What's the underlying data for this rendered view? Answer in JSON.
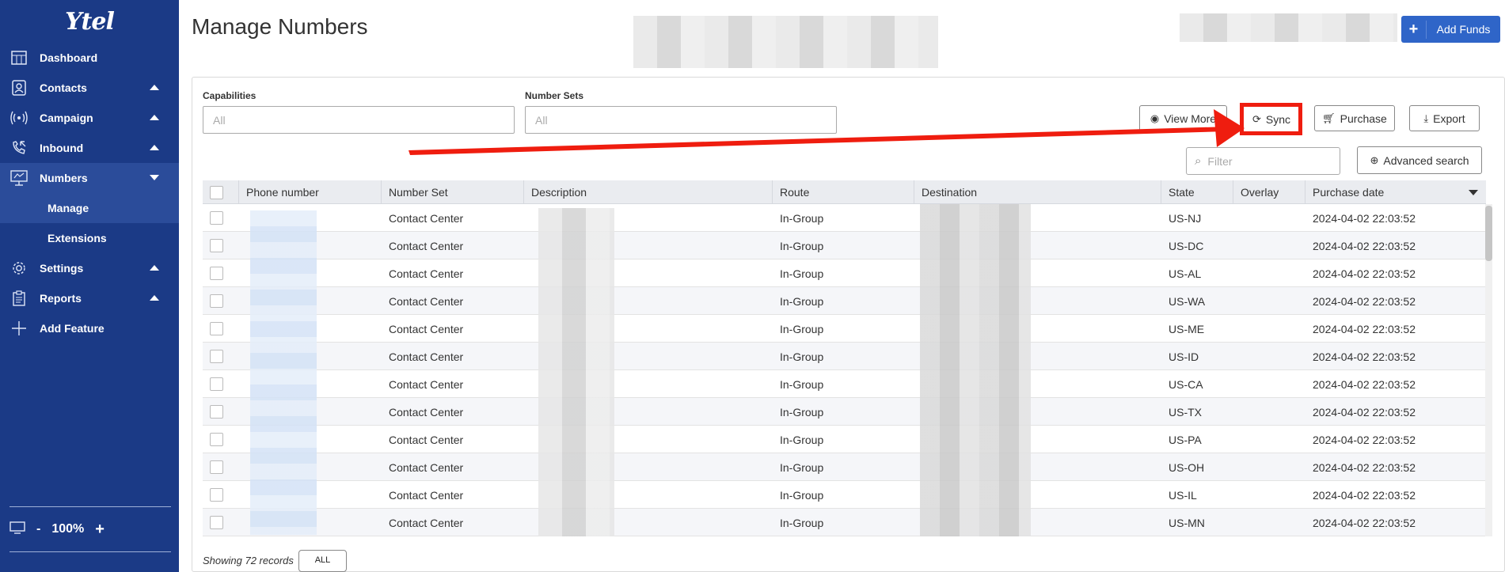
{
  "app": {
    "logo": "Ytel",
    "page_title": "Manage Numbers"
  },
  "sidebar": {
    "items": [
      {
        "label": "Dashboard",
        "icon": "dashboard-icon",
        "caret": ""
      },
      {
        "label": "Contacts",
        "icon": "contacts-icon",
        "caret": "up"
      },
      {
        "label": "Campaign",
        "icon": "campaign-icon",
        "caret": "up"
      },
      {
        "label": "Inbound",
        "icon": "inbound-icon",
        "caret": "up"
      },
      {
        "label": "Numbers",
        "icon": "numbers-icon",
        "caret": "down"
      }
    ],
    "numbers_sub": [
      {
        "label": "Manage"
      },
      {
        "label": "Extensions"
      }
    ],
    "lower_items": [
      {
        "label": "Settings",
        "icon": "gear-icon",
        "caret": "up"
      },
      {
        "label": "Reports",
        "icon": "reports-icon",
        "caret": "up"
      },
      {
        "label": "Add Feature",
        "icon": "plus-icon",
        "caret": ""
      }
    ],
    "zoom": {
      "minus": "-",
      "level": "100%",
      "plus": "+"
    }
  },
  "header": {
    "add_funds_plus": "+",
    "add_funds_label": "Add Funds"
  },
  "filters": {
    "capabilities_label": "Capabilities",
    "capabilities_placeholder": "All",
    "number_sets_label": "Number Sets",
    "number_sets_placeholder": "All",
    "filter_placeholder": "Filter"
  },
  "actions": {
    "view_more": "View More",
    "sync": "Sync",
    "purchase": "Purchase",
    "export": "Export",
    "advanced_search": "Advanced search"
  },
  "table": {
    "columns": [
      "Phone number",
      "Number Set",
      "Description",
      "Route",
      "Destination",
      "State",
      "Overlay",
      "Purchase date"
    ],
    "rows": [
      {
        "number_set": "Contact Center",
        "route": "In-Group",
        "state": "US-NJ",
        "purchase_date": "2024-04-02 22:03:52"
      },
      {
        "number_set": "Contact Center",
        "route": "In-Group",
        "state": "US-DC",
        "purchase_date": "2024-04-02 22:03:52"
      },
      {
        "number_set": "Contact Center",
        "route": "In-Group",
        "state": "US-AL",
        "purchase_date": "2024-04-02 22:03:52"
      },
      {
        "number_set": "Contact Center",
        "route": "In-Group",
        "state": "US-WA",
        "purchase_date": "2024-04-02 22:03:52"
      },
      {
        "number_set": "Contact Center",
        "route": "In-Group",
        "state": "US-ME",
        "purchase_date": "2024-04-02 22:03:52"
      },
      {
        "number_set": "Contact Center",
        "route": "In-Group",
        "state": "US-ID",
        "purchase_date": "2024-04-02 22:03:52"
      },
      {
        "number_set": "Contact Center",
        "route": "In-Group",
        "state": "US-CA",
        "purchase_date": "2024-04-02 22:03:52"
      },
      {
        "number_set": "Contact Center",
        "route": "In-Group",
        "state": "US-TX",
        "purchase_date": "2024-04-02 22:03:52"
      },
      {
        "number_set": "Contact Center",
        "route": "In-Group",
        "state": "US-PA",
        "purchase_date": "2024-04-02 22:03:52"
      },
      {
        "number_set": "Contact Center",
        "route": "In-Group",
        "state": "US-OH",
        "purchase_date": "2024-04-02 22:03:52"
      },
      {
        "number_set": "Contact Center",
        "route": "In-Group",
        "state": "US-IL",
        "purchase_date": "2024-04-02 22:03:52"
      },
      {
        "number_set": "Contact Center",
        "route": "In-Group",
        "state": "US-MN",
        "purchase_date": "2024-04-02 22:03:52"
      }
    ]
  },
  "footer": {
    "showing": "Showing 72 records",
    "all_button": "ALL"
  },
  "colors": {
    "sidebar": "#1b3a86",
    "sidebar_active": "#2b4c9a",
    "accent": "#2f65c8",
    "annotation_red": "#ef1d0f"
  }
}
